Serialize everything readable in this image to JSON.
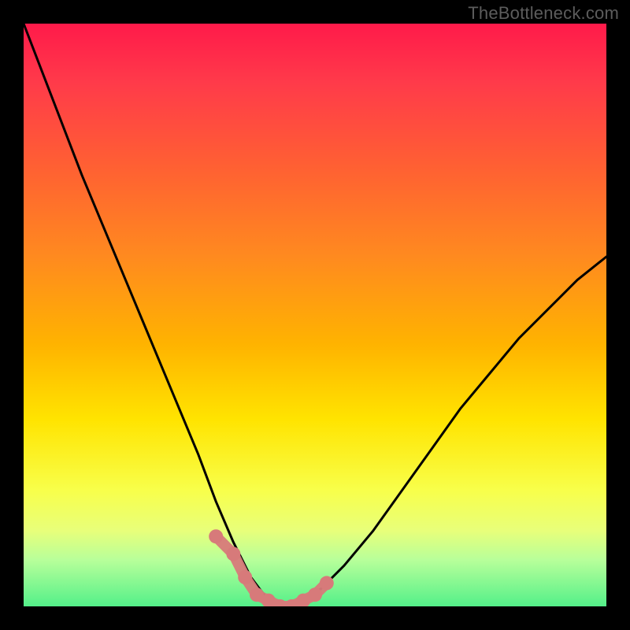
{
  "watermark": "TheBottleneck.com",
  "colors": {
    "background": "#000000",
    "gradient_top": "#ff1a4a",
    "gradient_bottom": "#54f089",
    "curve": "#000000",
    "markers": "#d77a7a"
  },
  "chart_data": {
    "type": "line",
    "title": "",
    "xlabel": "",
    "ylabel": "",
    "xlim": [
      0,
      1
    ],
    "ylim": [
      0,
      100
    ],
    "note": "V-shaped bottleneck curve; y is percentage where lower is better (green). Minimum ~0 around x≈0.40–0.47; right branch rises to ~60.",
    "x": [
      0.0,
      0.05,
      0.1,
      0.15,
      0.2,
      0.25,
      0.3,
      0.33,
      0.36,
      0.39,
      0.42,
      0.45,
      0.48,
      0.51,
      0.55,
      0.6,
      0.65,
      0.7,
      0.75,
      0.8,
      0.85,
      0.9,
      0.95,
      1.0
    ],
    "y": [
      100,
      87,
      74,
      62,
      50,
      38,
      26,
      18,
      11,
      5,
      1,
      0,
      1,
      3,
      7,
      13,
      20,
      27,
      34,
      40,
      46,
      51,
      56,
      60
    ],
    "markers": {
      "x": [
        0.33,
        0.36,
        0.38,
        0.4,
        0.42,
        0.44,
        0.46,
        0.48,
        0.5,
        0.52
      ],
      "y": [
        12,
        9,
        5,
        2,
        1,
        0,
        0,
        1,
        2,
        4
      ]
    }
  }
}
